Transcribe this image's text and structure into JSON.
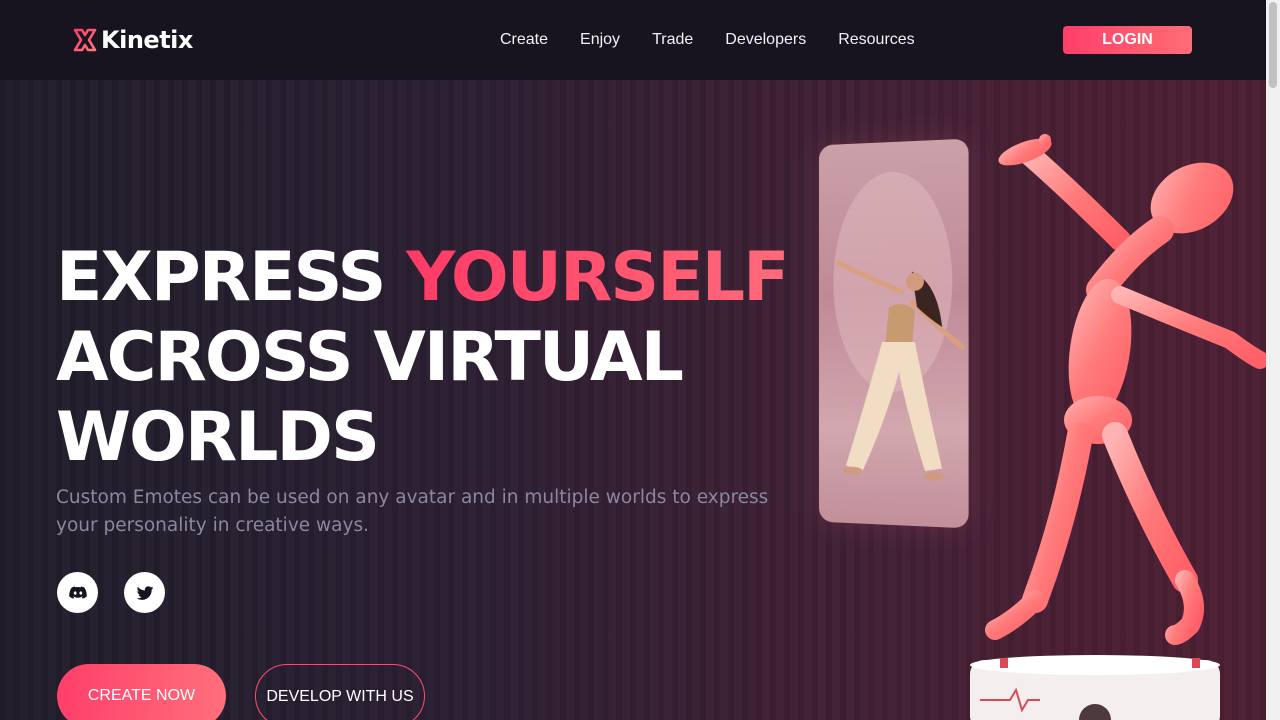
{
  "brand": {
    "name": "Kinetix",
    "accent_color": "#ff4a6e"
  },
  "nav": {
    "links": [
      "Create",
      "Enjoy",
      "Trade",
      "Developers",
      "Resources"
    ],
    "login_label": "LOGIN"
  },
  "hero": {
    "headline_part1": "EXPRESS ",
    "headline_accent": "YOURSELF",
    "headline_line2": "ACROSS VIRTUAL",
    "headline_line3": "WORLDS",
    "subtitle": "Custom Emotes can be used on any avatar and in multiple worlds to express your personality in creative ways.",
    "social": [
      {
        "icon": "discord-icon"
      },
      {
        "icon": "twitter-icon"
      }
    ],
    "cta_primary": "CREATE NOW",
    "cta_secondary": "DEVELOP WITH US"
  }
}
